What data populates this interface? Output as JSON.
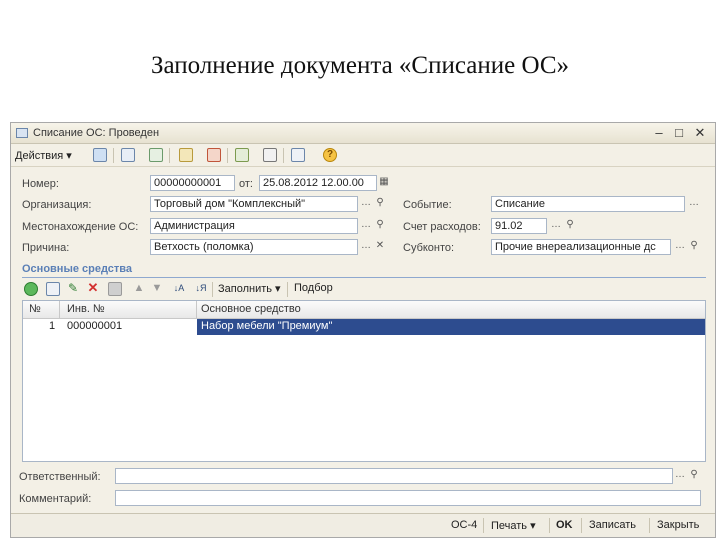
{
  "slide_title": "Заполнение документа «Списание ОС»",
  "window": {
    "title": "Списание ОС: Проведен",
    "controls": [
      "–",
      "□",
      "✕"
    ]
  },
  "toolbar": {
    "actions_label": "Действия ▾",
    "icons": [
      "add-icon",
      "copy-icon",
      "edit-icon",
      "save-icon",
      "post-icon",
      "unpost-icon",
      "structure-icon",
      "journal-icon",
      "list-icon",
      "help-icon"
    ]
  },
  "form": {
    "number_label": "Номер:",
    "number_value": "00000000001",
    "date_label": "от:",
    "date_value": "25.08.2012 12.00.00",
    "org_label": "Организация:",
    "org_value": "Торговый дом \"Комплексный\"",
    "location_label": "Местонахождение ОС:",
    "location_value": "Администрация",
    "reason_label": "Причина:",
    "reason_value": "Ветхость (поломка)",
    "event_label": "Событие:",
    "event_value": "Списание",
    "account_label": "Счет расходов:",
    "account_value": "91.02",
    "subconto_label": "Субконто:",
    "subconto_value": "Прочие внереализационные дс"
  },
  "assets": {
    "section_title": "Основные средства",
    "fill_label": "Заполнить ▾",
    "pick_label": "Подбор",
    "columns": [
      "№",
      "Инв. №",
      "Основное средство"
    ],
    "rows": [
      {
        "n": "1",
        "inv": "000000001",
        "asset": "Набор мебели \"Премиум\""
      }
    ]
  },
  "footer_fields": {
    "responsible_label": "Ответственный:",
    "responsible_value": "",
    "comment_label": "Комментарий:",
    "comment_value": ""
  },
  "bottom": {
    "form_label": "ОС-4",
    "print_label": "Печать ▾",
    "ok_label": "OK",
    "save_label": "Записать",
    "close_label": "Закрыть"
  },
  "colors": {
    "accent": "#5a7fb6",
    "selection": "#2d4c8f",
    "window_bg": "#f3f0e6"
  }
}
